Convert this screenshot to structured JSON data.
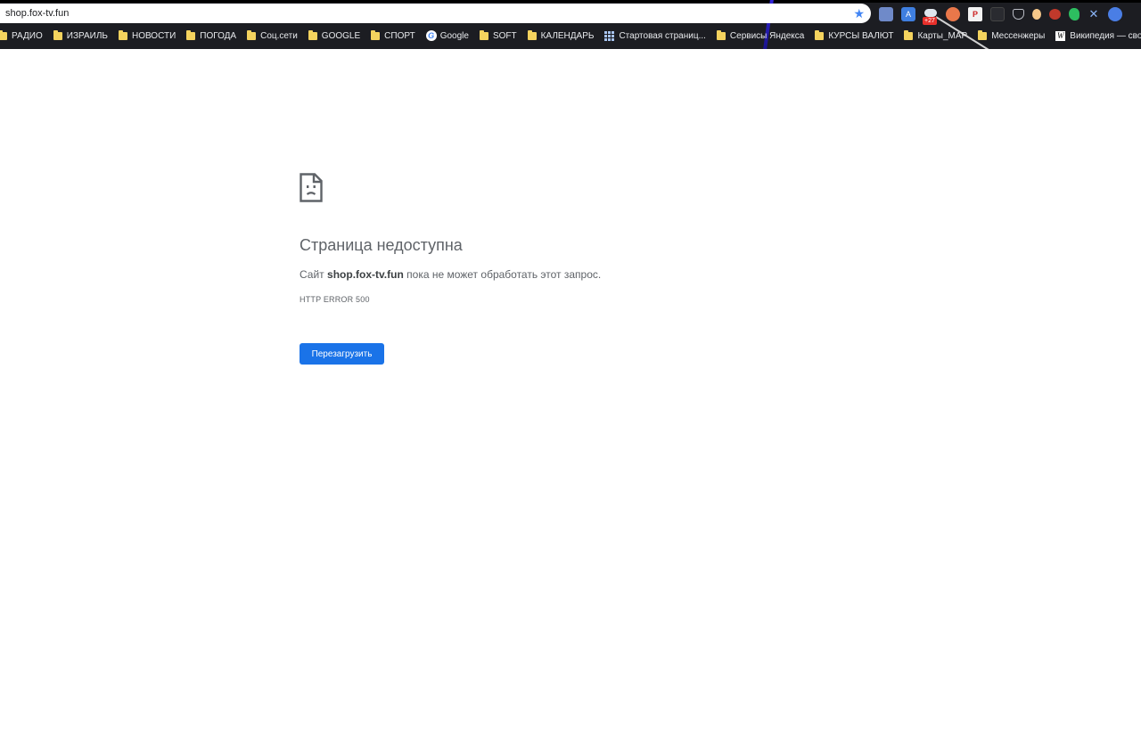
{
  "browser": {
    "address_bar": {
      "url": "shop.fox-tv.fun"
    },
    "extensions": [
      {
        "icon": "grid-icon"
      },
      {
        "icon": "translate-icon"
      },
      {
        "icon": "weather-icon",
        "badge": "+27"
      },
      {
        "icon": "orange-circle-icon"
      },
      {
        "icon": "pdf-icon"
      },
      {
        "icon": "dark-square-icon"
      },
      {
        "icon": "pocket-icon"
      },
      {
        "icon": "face-icon"
      },
      {
        "icon": "mask-icon"
      },
      {
        "icon": "evernote-icon"
      },
      {
        "icon": "x-icon"
      },
      {
        "icon": "blue-circle-icon"
      }
    ],
    "bookmarks": [
      {
        "label": "РАДИО",
        "icon": "folder-icon"
      },
      {
        "label": "ИЗРАИЛЬ",
        "icon": "folder-icon"
      },
      {
        "label": "НОВОСТИ",
        "icon": "folder-icon"
      },
      {
        "label": "ПОГОДА",
        "icon": "folder-icon"
      },
      {
        "label": "Соц.сети",
        "icon": "folder-icon"
      },
      {
        "label": "GOOGLE",
        "icon": "folder-icon"
      },
      {
        "label": "СПОРТ",
        "icon": "folder-icon"
      },
      {
        "label": "Google",
        "icon": "google-icon"
      },
      {
        "label": "SOFT",
        "icon": "folder-icon"
      },
      {
        "label": "КАЛЕНДАРЬ",
        "icon": "folder-icon"
      },
      {
        "label": "Стартовая страниц...",
        "icon": "grid-icon"
      },
      {
        "label": "Сервисы Яндекса",
        "icon": "folder-icon"
      },
      {
        "label": "КУРСЫ ВАЛЮТ",
        "icon": "folder-icon"
      },
      {
        "label": "Карты_МАР",
        "icon": "folder-icon"
      },
      {
        "label": "Мессенжеры",
        "icon": "folder-icon"
      },
      {
        "label": "Википедия — своб...",
        "icon": "wikipedia-icon"
      }
    ]
  },
  "error_page": {
    "title": "Страница недоступна",
    "desc_prefix": "Сайт",
    "site": "shop.fox-tv.fun",
    "desc_suffix": "пока не может обработать этот запрос.",
    "error_code": "HTTP ERROR 500",
    "reload_label": "Перезагрузить"
  },
  "colors": {
    "accent": "#1a73e8",
    "text_secondary": "#5f6368",
    "chrome_bg": "#1c1d22"
  }
}
